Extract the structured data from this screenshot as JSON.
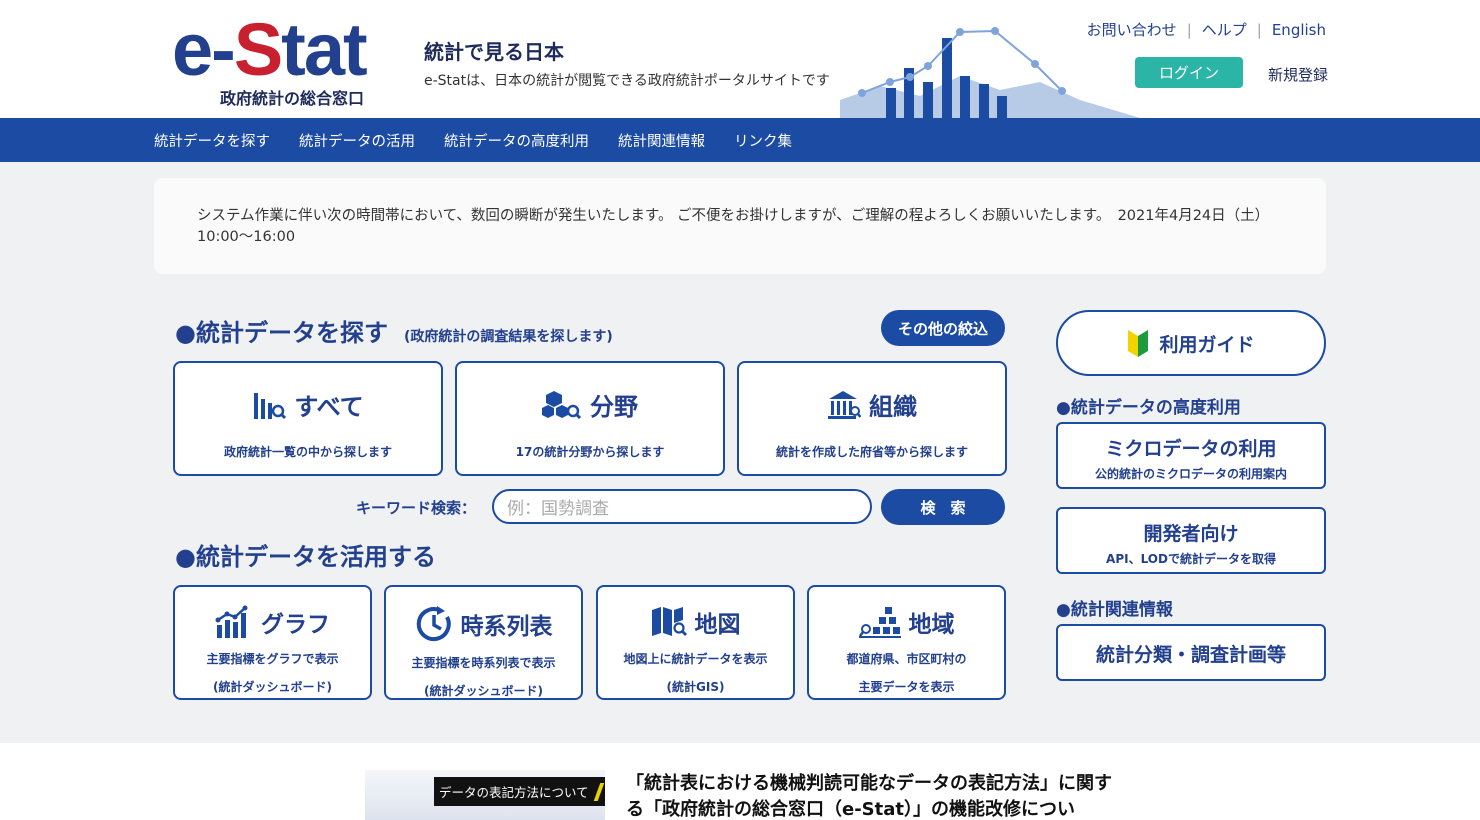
{
  "header": {
    "logo": {
      "e": "e",
      "dash": "-",
      "S": "S",
      "tat": "tat",
      "sub": "政府統計の総合窓口"
    },
    "tagline_title": "統計で見る日本",
    "tagline_sub": "e-Statは、日本の統計が閲覧できる政府統計ポータルサイトです",
    "links": {
      "contact": "お問い合わせ",
      "help": "ヘルプ",
      "english": "English",
      "sep": "|"
    },
    "login": "ログイン",
    "register": "新規登録"
  },
  "nav": {
    "items": [
      "統計データを探す",
      "統計データの活用",
      "統計データの高度利用",
      "統計関連情報",
      "リンク集"
    ]
  },
  "notice": {
    "text": "システム作業に伴い次の時間帯において、数回の瞬断が発生いたします。 ご不便をお掛けしますが、ご理解の程よろしくお願いいたします。　2021年4月24日（土）10:00〜16:00"
  },
  "search_section": {
    "title": "●統計データを探す",
    "note": "(政府統計の調査結果を探します)",
    "narrow_button": "その他の絞込",
    "cards": [
      {
        "label": "すべて",
        "desc": "政府統計一覧の中から探します",
        "icon": "bar-chart-search-icon"
      },
      {
        "label": "分野",
        "desc": "17の統計分野から探します",
        "icon": "cubes-search-icon"
      },
      {
        "label": "組織",
        "desc": "統計を作成した府省等から探します",
        "icon": "government-building-icon"
      }
    ],
    "keyword_label": "キーワード検索：",
    "keyword_placeholder": "例：国勢調査",
    "search_button": "検　索"
  },
  "use_section": {
    "title": "●統計データを活用する",
    "cards": [
      {
        "label": "グラフ",
        "desc1": "主要指標をグラフで表示",
        "desc2": "(統計ダッシュボード)",
        "icon": "graph-icon"
      },
      {
        "label": "時系列表",
        "desc1": "主要指標を時系列表で表示",
        "desc2": "(統計ダッシュボード)",
        "icon": "clock-icon"
      },
      {
        "label": "地図",
        "desc1": "地図上に統計データを表示",
        "desc2": "(統計GIS)",
        "icon": "map-icon"
      },
      {
        "label": "地域",
        "desc1": "都道府県、市区町村の",
        "desc2": "主要データを表示",
        "icon": "region-stairs-icon"
      }
    ]
  },
  "sidebar": {
    "guide": "利用ガイド",
    "advanced_title": "●統計データの高度利用",
    "micro": {
      "title": "ミクロデータの利用",
      "sub": "公的統計のミクロデータの利用案内"
    },
    "developer": {
      "title": "開発者向け",
      "sub": "API、LODで統計データを取得"
    },
    "related_title": "●統計関連情報",
    "classification": "統計分類・調査計画等"
  },
  "news": {
    "badge": "データの表記方法について",
    "title": "「統計表における機械判読可能なデータの表記方法」に関する「政府統計の総合窓口（e-Stat）」の機能改修につい"
  },
  "colors": {
    "navy": "#1c4ba3",
    "brand_red": "#c8202f",
    "teal": "#2bb5a7",
    "bg": "#eff1f3"
  }
}
